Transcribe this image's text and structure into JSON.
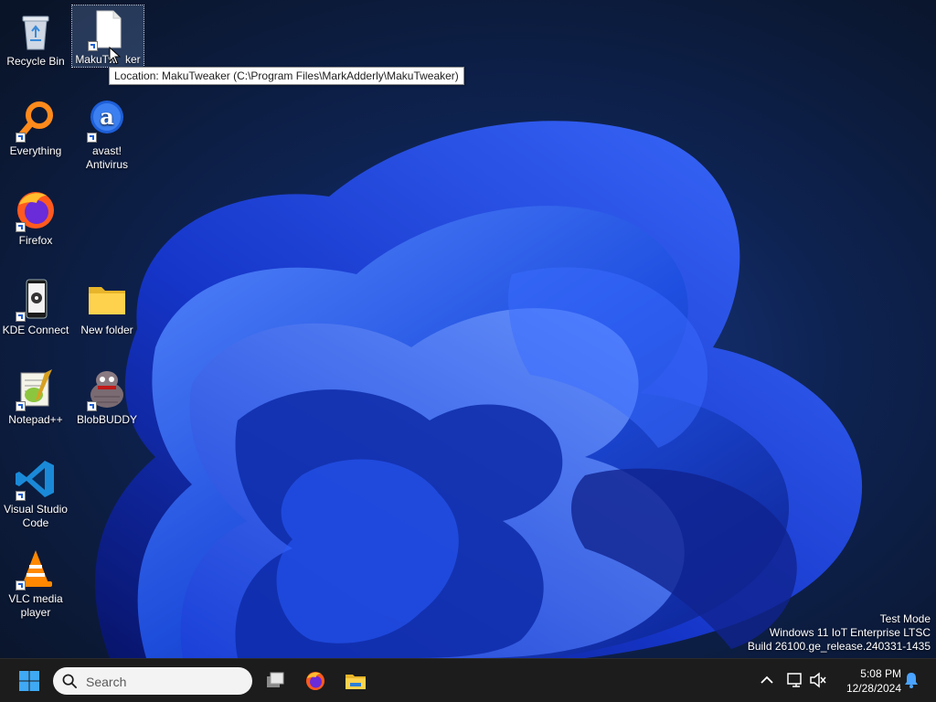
{
  "desktop": {
    "icons": [
      {
        "id": "recycle-bin",
        "label": "Recycle Bin",
        "icon": "recycle-bin-icon",
        "shortcut": false
      },
      {
        "id": "makutweaker",
        "label": "MakuTweaker",
        "icon": "blank-file-icon",
        "shortcut": true,
        "selected": true
      },
      {
        "id": "everything",
        "label": "Everything",
        "icon": "magnifier-icon",
        "shortcut": true
      },
      {
        "id": "avast",
        "label": "avast! Antivirus",
        "icon": "avast-icon",
        "shortcut": true
      },
      {
        "id": "firefox",
        "label": "Firefox",
        "icon": "firefox-icon",
        "shortcut": true
      },
      {
        "id": "kde-connect",
        "label": "KDE Connect",
        "icon": "kde-connect-icon",
        "shortcut": true
      },
      {
        "id": "new-folder",
        "label": "New folder",
        "icon": "folder-icon",
        "shortcut": false
      },
      {
        "id": "notepadpp",
        "label": "Notepad++",
        "icon": "notepadpp-icon",
        "shortcut": true
      },
      {
        "id": "blobbuddy",
        "label": "BlobBUDDY",
        "icon": "blob-icon",
        "shortcut": true
      },
      {
        "id": "vscode",
        "label": "Visual Studio Code",
        "icon": "vscode-icon",
        "shortcut": true
      },
      {
        "id": "vlc",
        "label": "VLC media player",
        "icon": "vlc-icon",
        "shortcut": true
      }
    ],
    "makutweaker_label_visible": "MakuTw",
    "makutweaker_label_tail": "ker",
    "tooltip": "Location: MakuTweaker (C:\\Program Files\\MarkAdderly\\MakuTweaker)"
  },
  "watermark": {
    "line1": "Test Mode",
    "line2": "Windows 11 IoT Enterprise LTSC",
    "line3": "Build 26100.ge_release.240331-1435"
  },
  "taskbar": {
    "search_placeholder": "Search",
    "time": "5:08 PM",
    "date": "12/28/2024"
  },
  "colors": {
    "taskbar_bg": "#1c1c1c",
    "start_blue": "#3fa9f5",
    "wallpaper_blue": "#1e4fe0"
  }
}
